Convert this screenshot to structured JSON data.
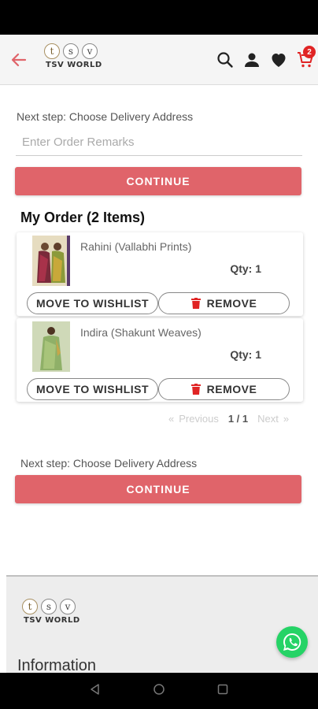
{
  "header": {
    "logo_letters": [
      "t",
      "s",
      "v"
    ],
    "logo_text": "TSV WORLD",
    "cart_count": "2"
  },
  "checkout": {
    "next_step_text": "Next step: Choose Delivery Address",
    "remarks_placeholder": "Enter Order Remarks",
    "continue_label": "CONTINUE"
  },
  "order": {
    "title": "My Order (2 Items)",
    "items": [
      {
        "name": "Rahini (Vallabhi Prints)",
        "qty": "Qty: 1",
        "wishlist_label": "MOVE TO WISHLIST",
        "remove_label": "REMOVE"
      },
      {
        "name": "Indira (Shakunt Weaves)",
        "qty": "Qty: 1",
        "wishlist_label": "MOVE TO WISHLIST",
        "remove_label": "REMOVE"
      }
    ]
  },
  "pagination": {
    "prev_arrow": "«",
    "previous": "Previous",
    "current": "1 / 1",
    "next": "Next",
    "next_arrow": "»"
  },
  "footer": {
    "logo_letters": [
      "t",
      "s",
      "v"
    ],
    "logo_text": "TSV WORLD",
    "section_title": "Information"
  },
  "colors": {
    "accent": "#e0646a",
    "badge": "#e02424",
    "whatsapp": "#25d366"
  }
}
